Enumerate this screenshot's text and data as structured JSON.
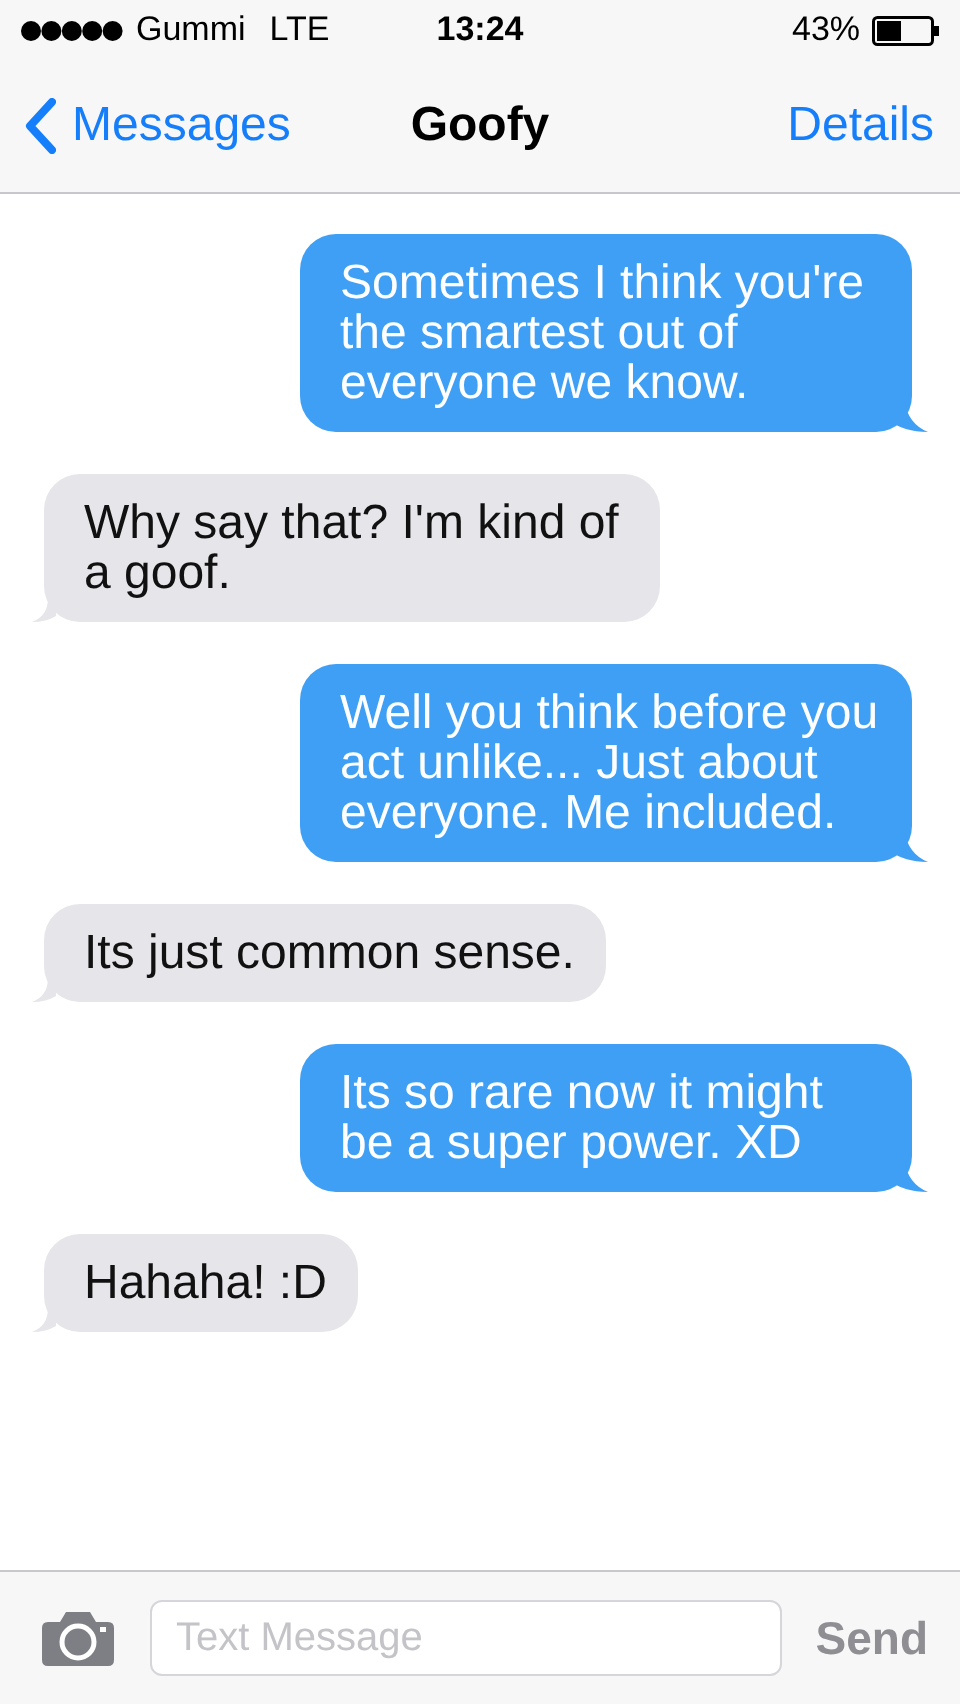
{
  "status_bar": {
    "carrier": "Gummi",
    "network": "LTE",
    "time": "13:24",
    "battery": "43%"
  },
  "nav": {
    "back": "Messages",
    "title": "Goofy",
    "action": "Details"
  },
  "messages": [
    {
      "kind": "sent",
      "text": "Sometimes I think you're the smartest out of everyone we know."
    },
    {
      "kind": "received",
      "text": "Why say that? I'm kind of a goof."
    },
    {
      "kind": "sent",
      "text": "Well you think before you act unlike... Just about everyone. Me included."
    },
    {
      "kind": "received",
      "text": "Its just common sense."
    },
    {
      "kind": "sent",
      "text": "Its so rare now it might be a super power. XD"
    },
    {
      "kind": "received",
      "text": "Hahaha! :D"
    }
  ],
  "composer": {
    "placeholder": "Text Message",
    "send": "Send"
  }
}
